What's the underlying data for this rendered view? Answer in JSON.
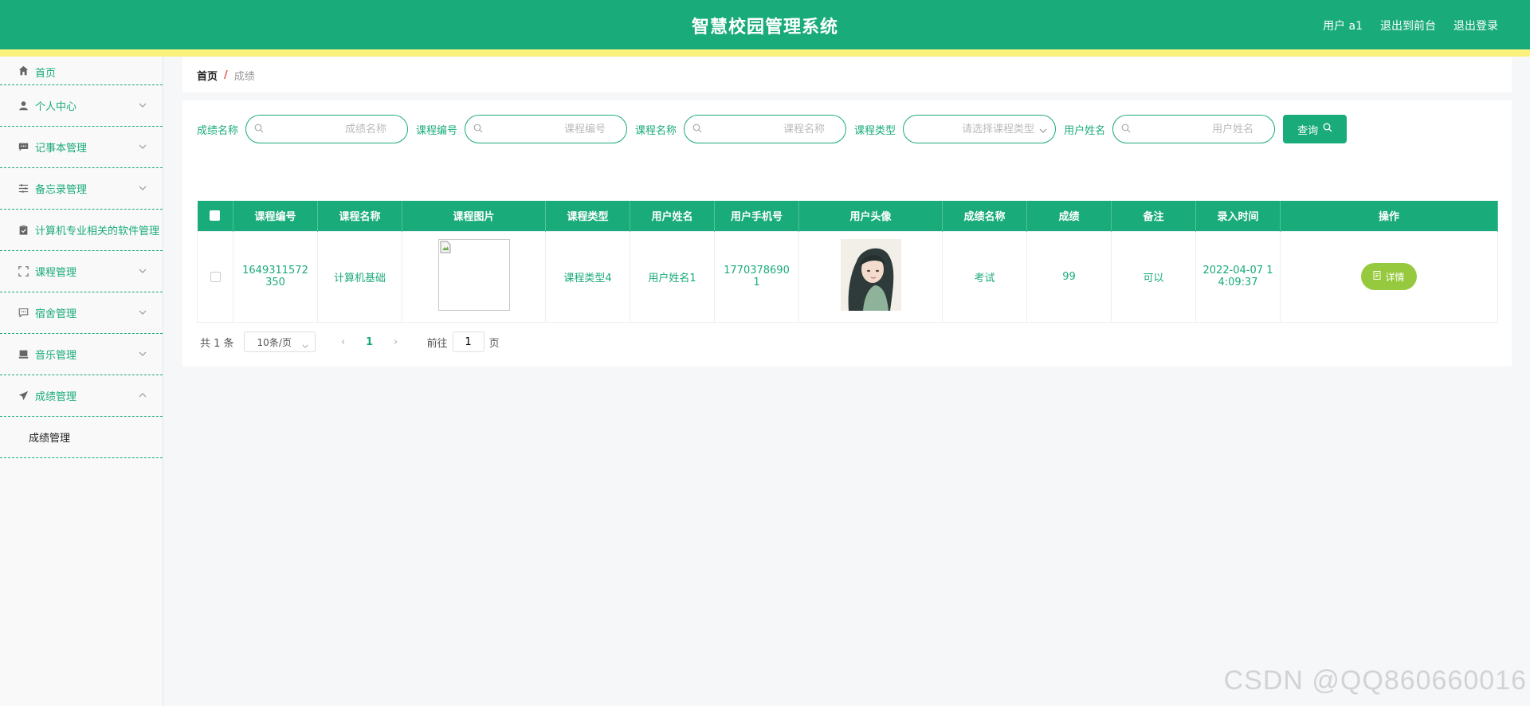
{
  "header": {
    "title": "智慧校园管理系统",
    "user_label": "用户 a1",
    "to_front_label": "退出到前台",
    "logout_label": "退出登录",
    "bg_color": "#1aab7a",
    "strip_color": "#fbf27e"
  },
  "sidebar": {
    "items": [
      {
        "label": "首页",
        "icon": "home-icon"
      },
      {
        "label": "个人中心",
        "icon": "user-icon"
      },
      {
        "label": "记事本管理",
        "icon": "message-icon"
      },
      {
        "label": "备忘录管理",
        "icon": "sliders-icon"
      },
      {
        "label": "计算机专业相关的软件管理",
        "icon": "clipboard-icon"
      },
      {
        "label": "课程管理",
        "icon": "frame-icon"
      },
      {
        "label": "宿舍管理",
        "icon": "chat-icon"
      },
      {
        "label": "音乐管理",
        "icon": "tray-icon"
      },
      {
        "label": "成绩管理",
        "icon": "send-icon"
      }
    ],
    "submenu": {
      "label": "成绩管理"
    }
  },
  "breadcrumb": {
    "home": "首页",
    "separator": "/",
    "current": "成绩"
  },
  "search": {
    "fields": [
      {
        "label": "成绩名称",
        "placeholder": "成绩名称"
      },
      {
        "label": "课程编号",
        "placeholder": "课程编号"
      },
      {
        "label": "课程名称",
        "placeholder": "课程名称"
      },
      {
        "label": "课程类型",
        "placeholder": "请选择课程类型"
      },
      {
        "label": "用户姓名",
        "placeholder": "用户姓名"
      }
    ],
    "query_label": "查询"
  },
  "table": {
    "headers": [
      "课程编号",
      "课程名称",
      "课程图片",
      "课程类型",
      "用户姓名",
      "用户手机号",
      "用户头像",
      "成绩名称",
      "成绩",
      "备注",
      "录入时间",
      "操作"
    ],
    "rows": [
      {
        "course_no": "1649311572350",
        "course_name": "计算机基础",
        "course_type": "课程类型4",
        "user_name": "用户姓名1",
        "phone": "17703786901",
        "score_name": "考试",
        "score": "99",
        "remark": "可以",
        "created": "2022-04-07 14:09:37",
        "action_label": "详情"
      }
    ]
  },
  "pagination": {
    "total_text": "共 1 条",
    "page_size": "10条/页",
    "current_page": "1",
    "goto_prefix": "前往",
    "goto_value": "1",
    "goto_suffix": "页"
  },
  "watermark": "CSDN @QQ860660016",
  "colors": {
    "accent": "#1aab7a",
    "detail_button": "#96c93d"
  }
}
